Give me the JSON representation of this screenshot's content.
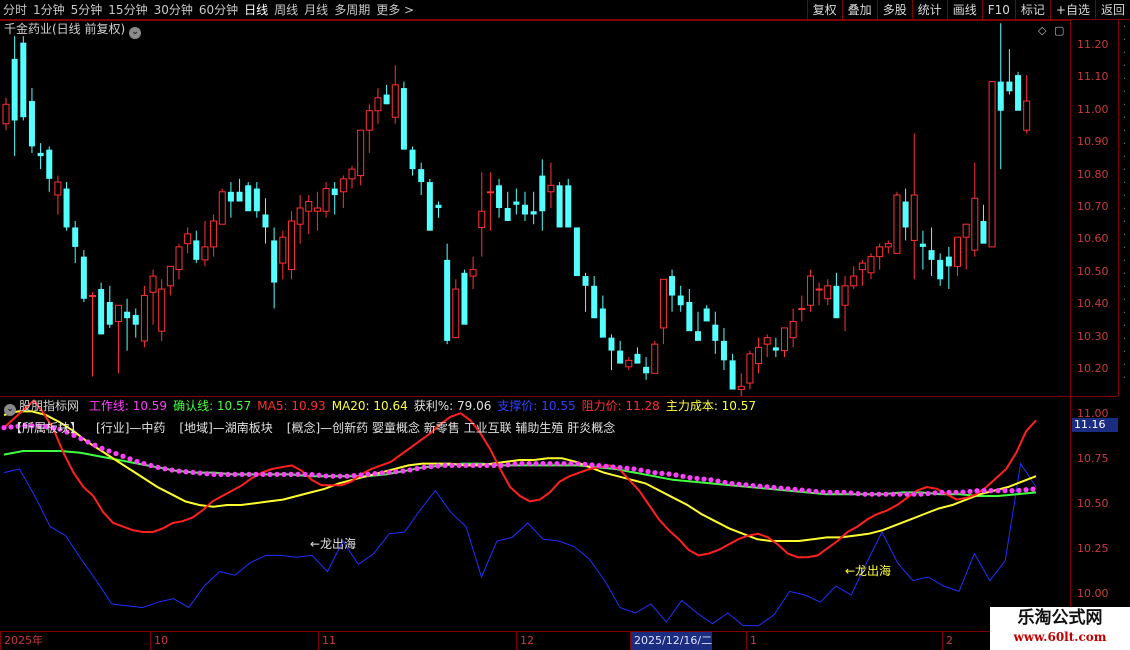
{
  "toolbar": {
    "periods": [
      "分时",
      "1分钟",
      "5分钟",
      "15分钟",
      "30分钟",
      "60分钟",
      "日线",
      "周线",
      "月线",
      "多周期",
      "更多 >"
    ],
    "active_period": "日线",
    "tools": [
      "复权",
      "叠加",
      "多股",
      "统计",
      "画线",
      "F10",
      "标记",
      "+自选",
      "返回"
    ]
  },
  "stock": {
    "title": "千金药业(日线 前复权)"
  },
  "price_axis": [
    "11.20",
    "11.10",
    "11.00",
    "10.90",
    "10.80",
    "10.70",
    "10.60",
    "10.50",
    "10.40",
    "10.30",
    "10.20"
  ],
  "indicator": {
    "name": "股朋指标网",
    "fields": [
      {
        "label": "工作线: 10.59",
        "color": "#ff40ff"
      },
      {
        "label": "确认线: 10.57",
        "color": "#40ff40"
      },
      {
        "label": "MA5: 10.93",
        "color": "#ff3030"
      },
      {
        "label": "MA20: 10.64",
        "color": "#ffff40"
      },
      {
        "label": "获利%: 79.06",
        "color": "#e0e0e0"
      },
      {
        "label": "支撑价: 10.55",
        "color": "#3040ff"
      },
      {
        "label": "阻力价: 11.28",
        "color": "#ff3030"
      },
      {
        "label": "主力成本: 10.57",
        "color": "#ffff40"
      }
    ],
    "sectors": [
      "【所属板块】",
      "[行业]—中药",
      "[地域]—湖南板块",
      "[概念]—创新药 婴童概念 新零售 工业互联 辅助生殖 肝炎概念"
    ],
    "axis": [
      "11.00",
      "10.75",
      "10.50",
      "10.25",
      "10.00"
    ],
    "badge": "11.16",
    "annotations": [
      "←龙出海",
      "←龙出海"
    ]
  },
  "dates": {
    "labels": [
      "2025年",
      "10",
      "11",
      "12",
      "2025/12/16/二",
      "1",
      "2"
    ],
    "selected": "2025/12/16/二"
  },
  "watermark": {
    "title": "乐淘公式网",
    "url": "www.60lt.com"
  },
  "colors": {
    "up": "#ff3232",
    "down": "#54ffff",
    "grid": "#800000",
    "work_line": "#ff40ff",
    "confirm_line": "#40ff40",
    "ma5": "#ff2020",
    "ma20": "#ffff30",
    "support": "#2030ff"
  },
  "candles": [
    [
      10.96,
      11.04,
      10.94,
      11.02
    ],
    [
      11.16,
      11.23,
      10.86,
      10.97
    ],
    [
      11.21,
      11.23,
      10.97,
      10.98
    ],
    [
      11.03,
      11.07,
      10.87,
      10.89
    ],
    [
      10.87,
      10.9,
      10.82,
      10.86
    ],
    [
      10.88,
      10.89,
      10.75,
      10.79
    ],
    [
      10.74,
      10.8,
      10.68,
      10.78
    ],
    [
      10.76,
      10.78,
      10.63,
      10.64
    ],
    [
      10.64,
      10.66,
      10.53,
      10.58
    ],
    [
      10.55,
      10.57,
      10.41,
      10.42
    ],
    [
      10.43,
      10.44,
      10.18,
      10.43
    ],
    [
      10.45,
      10.47,
      10.32,
      10.31
    ],
    [
      10.41,
      10.46,
      10.33,
      10.34
    ],
    [
      10.35,
      10.4,
      10.19,
      10.4
    ],
    [
      10.38,
      10.42,
      10.26,
      10.36
    ],
    [
      10.37,
      10.39,
      10.3,
      10.34
    ],
    [
      10.29,
      10.46,
      10.27,
      10.43
    ],
    [
      10.44,
      10.51,
      10.34,
      10.49
    ],
    [
      10.32,
      10.48,
      10.29,
      10.45
    ],
    [
      10.46,
      10.52,
      10.43,
      10.52
    ],
    [
      10.51,
      10.59,
      10.48,
      10.58
    ],
    [
      10.59,
      10.64,
      10.56,
      10.62
    ],
    [
      10.6,
      10.63,
      10.53,
      10.54
    ],
    [
      10.54,
      10.66,
      10.52,
      10.58
    ],
    [
      10.58,
      10.68,
      10.55,
      10.66
    ],
    [
      10.65,
      10.76,
      10.65,
      10.75
    ],
    [
      10.75,
      10.78,
      10.67,
      10.72
    ],
    [
      10.75,
      10.79,
      10.73,
      10.72
    ],
    [
      10.77,
      10.78,
      10.7,
      10.69
    ],
    [
      10.76,
      10.78,
      10.67,
      10.69
    ],
    [
      10.68,
      10.73,
      10.59,
      10.64
    ],
    [
      10.6,
      10.64,
      10.39,
      10.47
    ],
    [
      10.53,
      10.63,
      10.48,
      10.61
    ],
    [
      10.51,
      10.69,
      10.48,
      10.66
    ],
    [
      10.65,
      10.74,
      10.59,
      10.7
    ],
    [
      10.69,
      10.74,
      10.62,
      10.72
    ],
    [
      10.69,
      10.75,
      10.63,
      10.7
    ],
    [
      10.69,
      10.78,
      10.67,
      10.76
    ],
    [
      10.76,
      10.78,
      10.68,
      10.74
    ],
    [
      10.75,
      10.8,
      10.7,
      10.79
    ],
    [
      10.79,
      10.83,
      10.76,
      10.82
    ],
    [
      10.8,
      10.92,
      10.77,
      10.94
    ],
    [
      10.94,
      11.02,
      10.87,
      11.0
    ],
    [
      11.0,
      11.07,
      10.96,
      11.04
    ],
    [
      11.05,
      11.08,
      11.02,
      11.02
    ],
    [
      10.98,
      11.14,
      10.96,
      11.08
    ],
    [
      11.07,
      11.09,
      10.94,
      10.88
    ],
    [
      10.88,
      10.89,
      10.8,
      10.82
    ],
    [
      10.82,
      10.84,
      10.74,
      10.78
    ],
    [
      10.78,
      10.79,
      10.63,
      10.63
    ],
    [
      10.71,
      10.72,
      10.67,
      10.7
    ],
    [
      10.54,
      10.59,
      10.28,
      10.29
    ],
    [
      10.3,
      10.48,
      10.3,
      10.45
    ],
    [
      10.5,
      10.51,
      10.41,
      10.34
    ],
    [
      10.49,
      10.55,
      10.45,
      10.51
    ],
    [
      10.64,
      10.81,
      10.55,
      10.69
    ],
    [
      10.75,
      10.81,
      10.63,
      10.75
    ],
    [
      10.77,
      10.79,
      10.67,
      10.7
    ],
    [
      10.7,
      10.75,
      10.68,
      10.66
    ],
    [
      10.72,
      10.76,
      10.68,
      10.71
    ],
    [
      10.71,
      10.75,
      10.66,
      10.68
    ],
    [
      10.69,
      10.75,
      10.65,
      10.68
    ],
    [
      10.8,
      10.85,
      10.63,
      10.69
    ],
    [
      10.75,
      10.84,
      10.7,
      10.77
    ],
    [
      10.77,
      10.78,
      10.66,
      10.64
    ],
    [
      10.77,
      10.79,
      10.66,
      10.64
    ],
    [
      10.64,
      10.64,
      10.51,
      10.49
    ],
    [
      10.49,
      10.5,
      10.38,
      10.46
    ],
    [
      10.46,
      10.49,
      10.36,
      10.36
    ],
    [
      10.39,
      10.43,
      10.34,
      10.3
    ],
    [
      10.3,
      10.31,
      10.2,
      10.26
    ],
    [
      10.26,
      10.29,
      10.24,
      10.22
    ],
    [
      10.21,
      10.24,
      10.2,
      10.23
    ],
    [
      10.25,
      10.27,
      10.24,
      10.22
    ],
    [
      10.21,
      10.24,
      10.17,
      10.19
    ],
    [
      10.19,
      10.29,
      10.19,
      10.28
    ],
    [
      10.33,
      10.47,
      10.28,
      10.48
    ],
    [
      10.49,
      10.51,
      10.38,
      10.43
    ],
    [
      10.43,
      10.46,
      10.38,
      10.4
    ],
    [
      10.41,
      10.45,
      10.37,
      10.32
    ],
    [
      10.32,
      10.38,
      10.3,
      10.29
    ],
    [
      10.39,
      10.4,
      10.35,
      10.35
    ],
    [
      10.34,
      10.38,
      10.25,
      10.29
    ],
    [
      10.29,
      10.33,
      10.2,
      10.23
    ],
    [
      10.23,
      10.25,
      10.17,
      10.14
    ],
    [
      10.14,
      10.19,
      10.12,
      10.15
    ],
    [
      10.16,
      10.26,
      10.14,
      10.25
    ],
    [
      10.22,
      10.3,
      10.19,
      10.27
    ],
    [
      10.28,
      10.31,
      10.24,
      10.3
    ],
    [
      10.27,
      10.3,
      10.24,
      10.26
    ],
    [
      10.26,
      10.33,
      10.24,
      10.33
    ],
    [
      10.3,
      10.39,
      10.27,
      10.35
    ],
    [
      10.39,
      10.43,
      10.35,
      10.39
    ],
    [
      10.4,
      10.51,
      10.38,
      10.49
    ],
    [
      10.45,
      10.47,
      10.4,
      10.45
    ],
    [
      10.42,
      10.48,
      10.4,
      10.46
    ],
    [
      10.46,
      10.5,
      10.43,
      10.36
    ],
    [
      10.4,
      10.49,
      10.32,
      10.46
    ],
    [
      10.46,
      10.52,
      10.45,
      10.49
    ],
    [
      10.51,
      10.54,
      10.46,
      10.53
    ],
    [
      10.5,
      10.56,
      10.48,
      10.55
    ],
    [
      10.55,
      10.59,
      10.51,
      10.58
    ],
    [
      10.58,
      10.6,
      10.56,
      10.59
    ],
    [
      10.56,
      10.75,
      10.56,
      10.74
    ],
    [
      10.72,
      10.76,
      10.6,
      10.64
    ],
    [
      10.6,
      10.93,
      10.48,
      10.74
    ],
    [
      10.59,
      10.63,
      10.51,
      10.58
    ],
    [
      10.57,
      10.64,
      10.49,
      10.54
    ],
    [
      10.54,
      10.56,
      10.46,
      10.48
    ],
    [
      10.55,
      10.58,
      10.45,
      10.52
    ],
    [
      10.52,
      10.6,
      10.49,
      10.61
    ],
    [
      10.61,
      10.63,
      10.51,
      10.65
    ],
    [
      10.57,
      10.84,
      10.55,
      10.73
    ],
    [
      10.66,
      10.71,
      10.61,
      10.59
    ],
    [
      10.58,
      10.85,
      10.58,
      11.09
    ],
    [
      11.09,
      11.27,
      10.82,
      11.0
    ],
    [
      11.09,
      11.19,
      11.05,
      11.06
    ],
    [
      11.11,
      11.12,
      11.02,
      11.0
    ],
    [
      10.94,
      11.11,
      10.93,
      11.03
    ]
  ],
  "sub_series": {
    "ma5": [
      10.93,
      10.98,
      11.03,
      11.08,
      11.01,
      10.92,
      10.79,
      10.68,
      10.6,
      10.55,
      10.46,
      10.4,
      10.38,
      10.36,
      10.35,
      10.35,
      10.37,
      10.4,
      10.41,
      10.43,
      10.47,
      10.52,
      10.55,
      10.58,
      10.61,
      10.65,
      10.68,
      10.7,
      10.71,
      10.72,
      10.69,
      10.64,
      10.61,
      10.61,
      10.61,
      10.63,
      10.67,
      10.7,
      10.72,
      10.74,
      10.78,
      10.82,
      10.86,
      10.9,
      10.95,
      10.99,
      11.01,
      10.97,
      10.9,
      10.81,
      10.7,
      10.6,
      10.55,
      10.52,
      10.53,
      10.57,
      10.63,
      10.66,
      10.68,
      10.7,
      10.71,
      10.72,
      10.7,
      10.64,
      10.58,
      10.5,
      10.42,
      10.36,
      10.31,
      10.25,
      10.22,
      10.23,
      10.25,
      10.28,
      10.31,
      10.33,
      10.34,
      10.32,
      10.28,
      10.23,
      10.21,
      10.21,
      10.22,
      10.26,
      10.3,
      10.35,
      10.38,
      10.42,
      10.45,
      10.47,
      10.5,
      10.54,
      10.58,
      10.6,
      10.59,
      10.56,
      10.53,
      10.54,
      10.56,
      10.6,
      10.65,
      10.7,
      10.79,
      10.91,
      10.97
    ],
    "ma20": [
      11.0,
      11.02,
      11.02,
      11.0,
      10.96,
      10.91,
      10.85,
      10.8,
      10.75,
      10.7,
      10.65,
      10.6,
      10.56,
      10.52,
      10.5,
      10.49,
      10.5,
      10.5,
      10.51,
      10.52,
      10.53,
      10.55,
      10.57,
      10.59,
      10.62,
      10.64,
      10.66,
      10.68,
      10.7,
      10.72,
      10.73,
      10.73,
      10.73,
      10.72,
      10.72,
      10.73,
      10.74,
      10.75,
      10.75,
      10.76,
      10.76,
      10.74,
      10.71,
      10.68,
      10.66,
      10.64,
      10.62,
      10.58,
      10.54,
      10.5,
      10.45,
      10.41,
      10.37,
      10.34,
      10.31,
      10.3,
      10.3,
      10.3,
      10.31,
      10.32,
      10.32,
      10.33,
      10.34,
      10.36,
      10.39,
      10.42,
      10.45,
      10.48,
      10.5,
      10.53,
      10.56,
      10.58,
      10.6,
      10.63,
      10.66
    ],
    "work": [
      10.93,
      10.94,
      10.94,
      10.92,
      10.87,
      10.82,
      10.78,
      10.74,
      10.71,
      10.69,
      10.68,
      10.67,
      10.67,
      10.67,
      10.67,
      10.67,
      10.67,
      10.66,
      10.66,
      10.67,
      10.68,
      10.69,
      10.71,
      10.72,
      10.72,
      10.72,
      10.72,
      10.73,
      10.73,
      10.73,
      10.73,
      10.72,
      10.71,
      10.7,
      10.68,
      10.67,
      10.65,
      10.64,
      10.62,
      10.61,
      10.6,
      10.59,
      10.58,
      10.57,
      10.57,
      10.56,
      10.56,
      10.56,
      10.56,
      10.57,
      10.57,
      10.58,
      10.58,
      10.58,
      10.59
    ],
    "confirm": [
      10.78,
      10.8,
      10.8,
      10.8,
      10.79,
      10.77,
      10.75,
      10.73,
      10.71,
      10.69,
      10.68,
      10.68,
      10.67,
      10.67,
      10.67,
      10.67,
      10.66,
      10.66,
      10.66,
      10.66,
      10.67,
      10.69,
      10.71,
      10.72,
      10.73,
      10.73,
      10.72,
      10.72,
      10.72,
      10.72,
      10.72,
      10.71,
      10.7,
      10.68,
      10.66,
      10.64,
      10.63,
      10.62,
      10.61,
      10.6,
      10.59,
      10.58,
      10.57,
      10.56,
      10.56,
      10.56,
      10.56,
      10.57,
      10.57,
      10.56,
      10.56,
      10.55,
      10.55,
      10.56,
      10.57
    ],
    "support": [
      10.68,
      10.7,
      10.55,
      10.38,
      10.33,
      10.2,
      10.08,
      9.95,
      9.94,
      9.93,
      9.96,
      9.98,
      9.93,
      10.05,
      10.13,
      10.11,
      10.18,
      10.22,
      10.22,
      10.21,
      10.22,
      10.13,
      10.3,
      10.17,
      10.23,
      10.34,
      10.35,
      10.47,
      10.58,
      10.46,
      10.38,
      10.1,
      10.3,
      10.32,
      10.4,
      10.31,
      10.3,
      10.27,
      10.2,
      10.08,
      9.93,
      9.9,
      9.95,
      9.85,
      9.97,
      9.9,
      9.84,
      9.9,
      9.83,
      9.83,
      9.89,
      10.02,
      10.0,
      9.96,
      10.05,
      10.0,
      10.18,
      10.35,
      10.18,
      10.08,
      10.1,
      10.05,
      10.02,
      10.23,
      10.08,
      10.19,
      10.73,
      10.6
    ]
  }
}
